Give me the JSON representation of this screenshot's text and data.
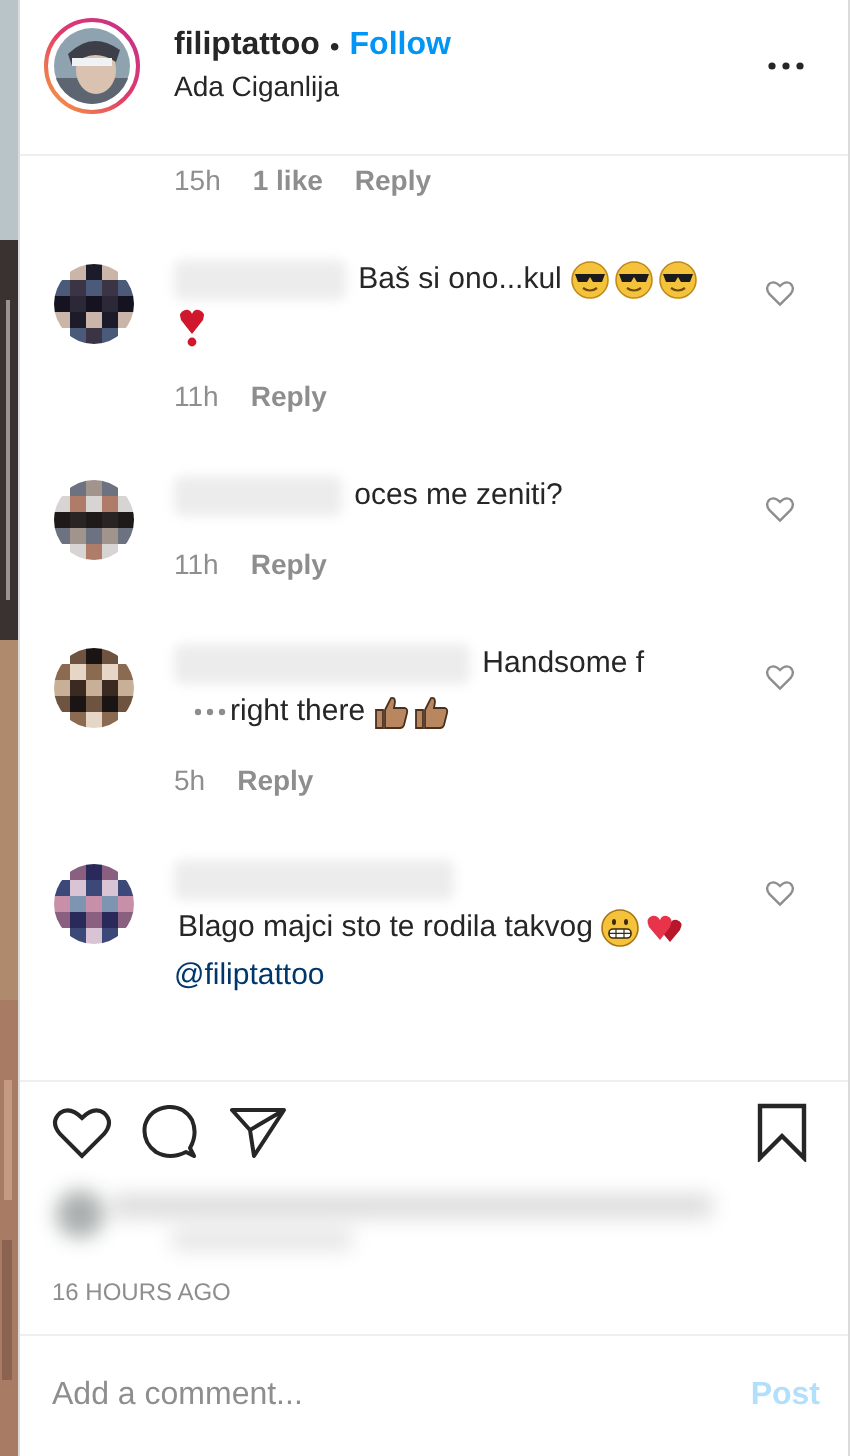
{
  "header": {
    "username": "filiptattoo",
    "separator": "•",
    "follow": "Follow",
    "location": "Ada Ciganlija"
  },
  "top_meta": {
    "time": "15h",
    "likes": "1 like",
    "reply": "Reply"
  },
  "comments": [
    {
      "body": [
        {
          "kind": "text",
          "text": "Baš si ono...kul"
        },
        {
          "kind": "sunglasses"
        },
        {
          "kind": "sunglasses"
        },
        {
          "kind": "sunglasses"
        },
        {
          "kind": "heart"
        }
      ],
      "time": "11h",
      "reply": "Reply",
      "liked": false
    },
    {
      "body": [
        {
          "kind": "text",
          "text": "oces me zeniti?"
        }
      ],
      "time": "11h",
      "reply": "Reply",
      "liked": false
    },
    {
      "body": [
        {
          "kind": "text",
          "text": "Handsome f"
        },
        {
          "kind": "more"
        },
        {
          "kind": "text",
          "text": "right there"
        },
        {
          "kind": "thumbsup"
        },
        {
          "kind": "thumbsup"
        }
      ],
      "time": "5h",
      "reply": "Reply",
      "liked": false
    },
    {
      "body": [
        {
          "kind": "text",
          "text": "Blago majci sto"
        },
        {
          "kind": "text",
          "text": "te rodila takvog"
        },
        {
          "kind": "grin"
        },
        {
          "kind": "hearts"
        },
        {
          "kind": "mention",
          "text": "@filiptattoo"
        }
      ],
      "liked": false
    }
  ],
  "time_ago": "16 HOURS AGO",
  "comment_input": {
    "placeholder": "Add a comment...",
    "post": "Post",
    "post_disabled": true
  }
}
